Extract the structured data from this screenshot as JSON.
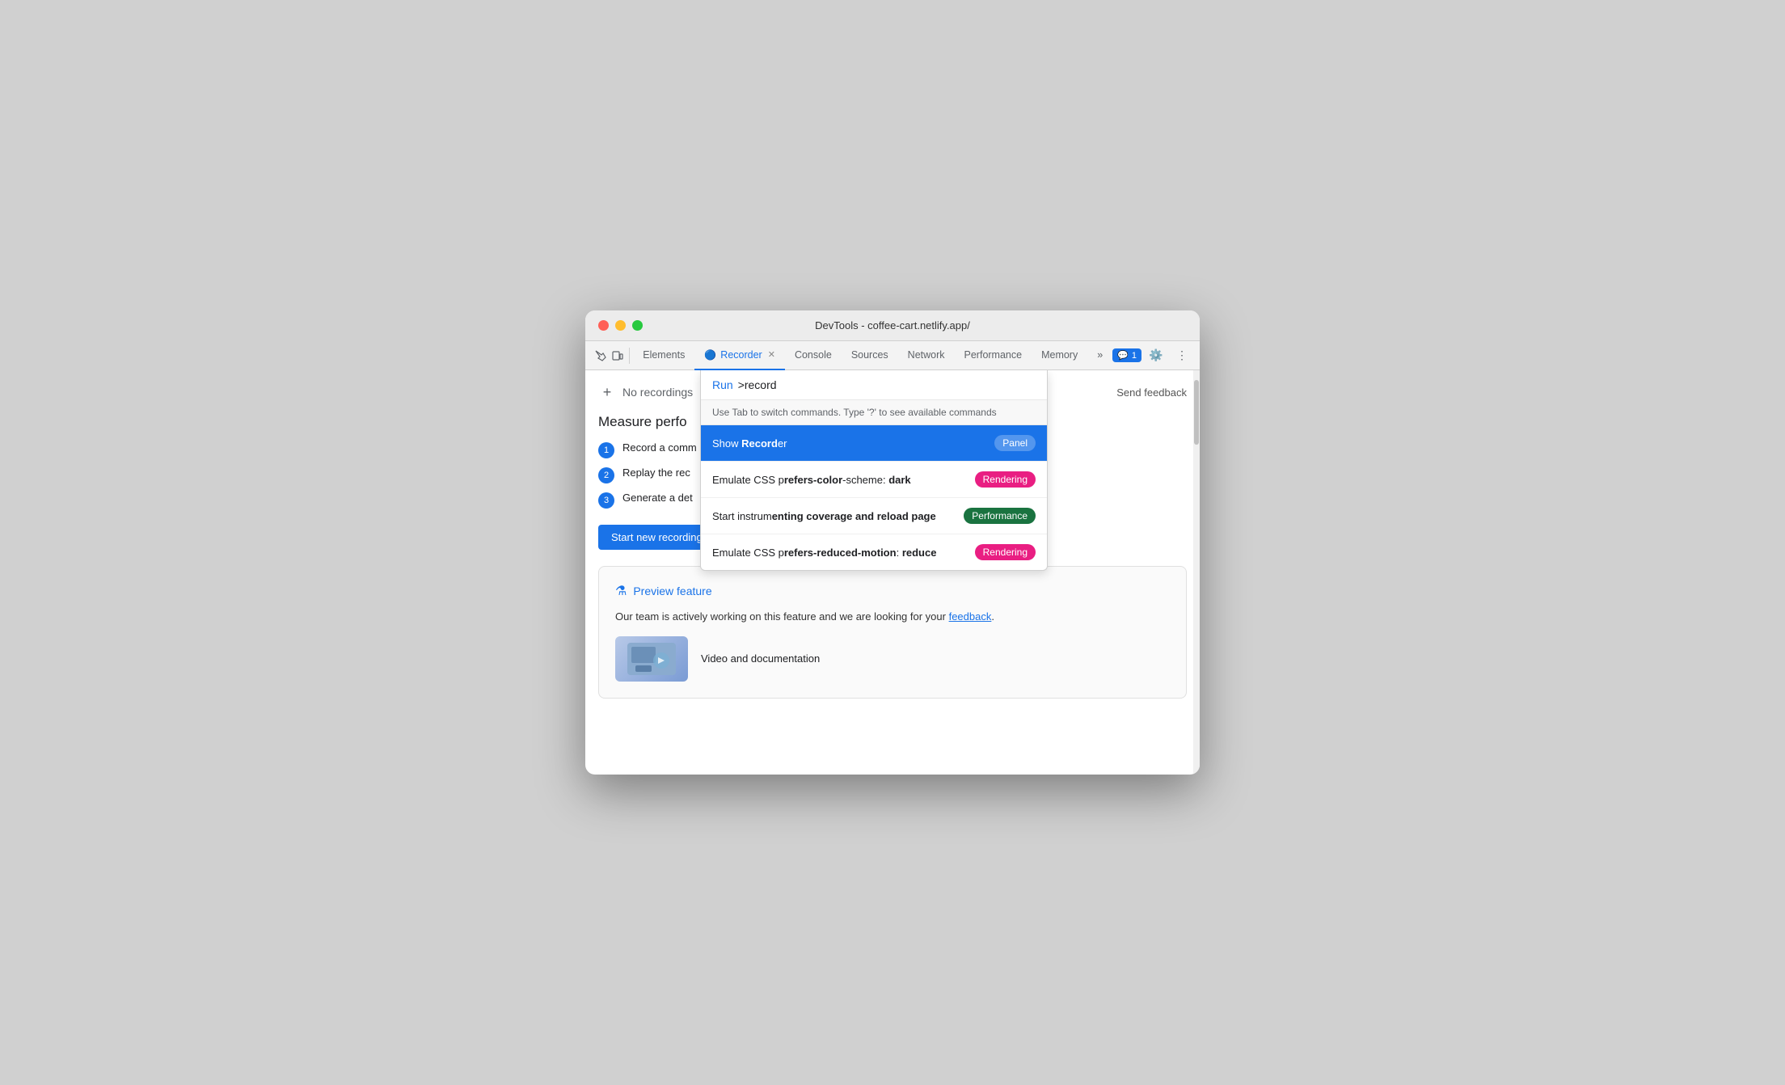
{
  "window": {
    "title": "DevTools - coffee-cart.netlify.app/"
  },
  "toolbar": {
    "tabs": [
      {
        "id": "elements",
        "label": "Elements",
        "active": false
      },
      {
        "id": "recorder",
        "label": "Recorder",
        "active": true,
        "hasIcon": true,
        "hasClose": true
      },
      {
        "id": "console",
        "label": "Console",
        "active": false
      },
      {
        "id": "sources",
        "label": "Sources",
        "active": false
      },
      {
        "id": "network",
        "label": "Network",
        "active": false
      },
      {
        "id": "performance",
        "label": "Performance",
        "active": false
      },
      {
        "id": "memory",
        "label": "Memory",
        "active": false
      }
    ],
    "more_label": "»",
    "feedback_badge": "1",
    "settings_icon": "⚙",
    "more_icon": "⋮"
  },
  "panel": {
    "add_icon": "+",
    "no_recordings": "No recordings",
    "send_feedback": "Send feedback",
    "measure_title": "Measure perfo",
    "steps": [
      {
        "num": "1",
        "text": "Record a comm"
      },
      {
        "num": "2",
        "text": "Replay the rec"
      },
      {
        "num": "3",
        "text": "Generate a det"
      }
    ],
    "start_recording_btn": "Start new recording",
    "preview_feature_label": "Preview feature",
    "preview_text": "Our team is actively working on this feature and we are looking for your ",
    "preview_link": "feedback",
    "preview_period": ".",
    "video_doc_label": "Video and documentation"
  },
  "command_palette": {
    "run_label": "Run",
    "input_value": ">record",
    "hint": "Use Tab to switch commands. Type '?' to see available commands",
    "items": [
      {
        "id": "show-recorder",
        "text_before": "Show ",
        "highlight": "Record",
        "text_after": "er",
        "badge_label": "Panel",
        "badge_class": "badge-panel",
        "selected": true
      },
      {
        "id": "emulate-css-color",
        "text_before": "Emulate CSS p",
        "highlight": "refers-color",
        "text_after": "-scheme: ",
        "text_bold": "dark",
        "badge_label": "Rendering",
        "badge_class": "badge-rendering",
        "selected": false
      },
      {
        "id": "start-coverage",
        "text_before": "Start instrum",
        "highlight": "enting c",
        "text_after": "",
        "text_bold_parts": "overage and reload page",
        "badge_label": "Performance",
        "badge_class": "badge-performance",
        "selected": false
      },
      {
        "id": "emulate-css-motion",
        "text_before": "Emulate CSS p",
        "highlight": "refers-reduced-motion",
        "text_after": ": ",
        "text_bold": "reduce",
        "badge_label": "Rendering",
        "badge_class": "badge-rendering",
        "selected": false
      }
    ]
  }
}
